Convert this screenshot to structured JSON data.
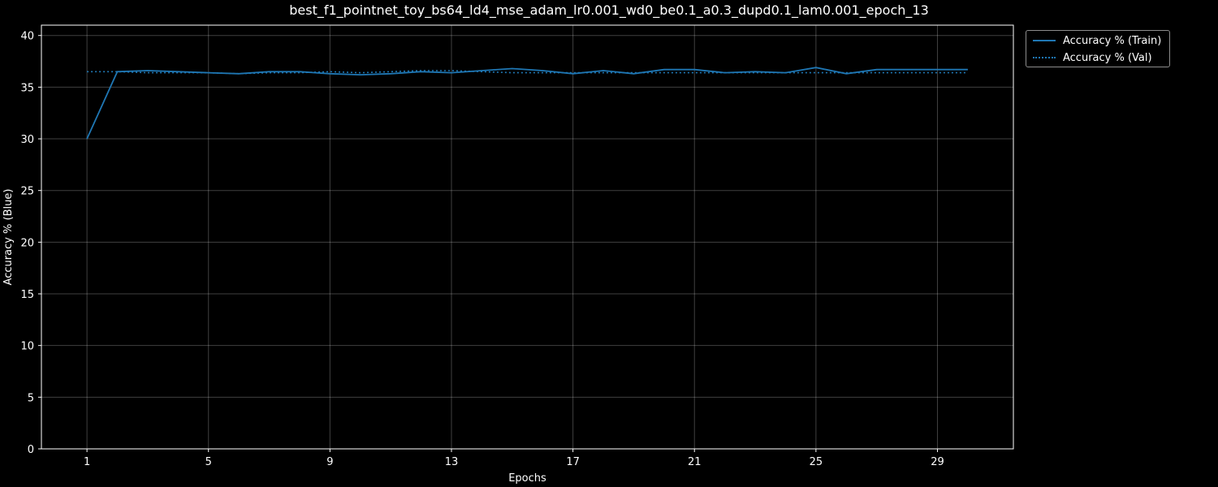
{
  "chart_data": {
    "type": "line",
    "title": "best_f1_pointnet_toy_bs64_ld4_mse_adam_lr0.001_wd0_be0.1_a0.3_dupd0.1_lam0.001_epoch_13",
    "xlabel": "Epochs",
    "ylabel": "Accuracy % (Blue)",
    "xlim": [
      -0.5,
      31.5
    ],
    "ylim": [
      0,
      41
    ],
    "xticks": [
      1,
      5,
      9,
      13,
      17,
      21,
      25,
      29
    ],
    "yticks": [
      0,
      5,
      10,
      15,
      20,
      25,
      30,
      35,
      40
    ],
    "grid": true,
    "legend_position": "outside-top-right",
    "x": [
      1,
      2,
      3,
      4,
      5,
      6,
      7,
      8,
      9,
      10,
      11,
      12,
      13,
      14,
      15,
      16,
      17,
      18,
      19,
      20,
      21,
      22,
      23,
      24,
      25,
      26,
      27,
      28,
      29,
      30
    ],
    "series": [
      {
        "name": "Accuracy % (Train)",
        "style": "solid",
        "color": "#1f77b4",
        "values": [
          30.0,
          36.5,
          36.6,
          36.5,
          36.4,
          36.3,
          36.5,
          36.5,
          36.3,
          36.2,
          36.3,
          36.5,
          36.4,
          36.6,
          36.8,
          36.6,
          36.3,
          36.6,
          36.3,
          36.7,
          36.7,
          36.4,
          36.5,
          36.4,
          36.9,
          36.3,
          36.7,
          36.7,
          36.7,
          36.7
        ]
      },
      {
        "name": "Accuracy % (Val)",
        "style": "dotted",
        "color": "#1f77b4",
        "values": [
          36.5,
          36.5,
          36.4,
          36.4,
          36.4,
          36.3,
          36.4,
          36.4,
          36.5,
          36.4,
          36.5,
          36.6,
          36.6,
          36.5,
          36.4,
          36.4,
          36.4,
          36.4,
          36.4,
          36.4,
          36.4,
          36.4,
          36.4,
          36.4,
          36.4,
          36.4,
          36.4,
          36.4,
          36.4,
          36.4
        ]
      }
    ]
  }
}
